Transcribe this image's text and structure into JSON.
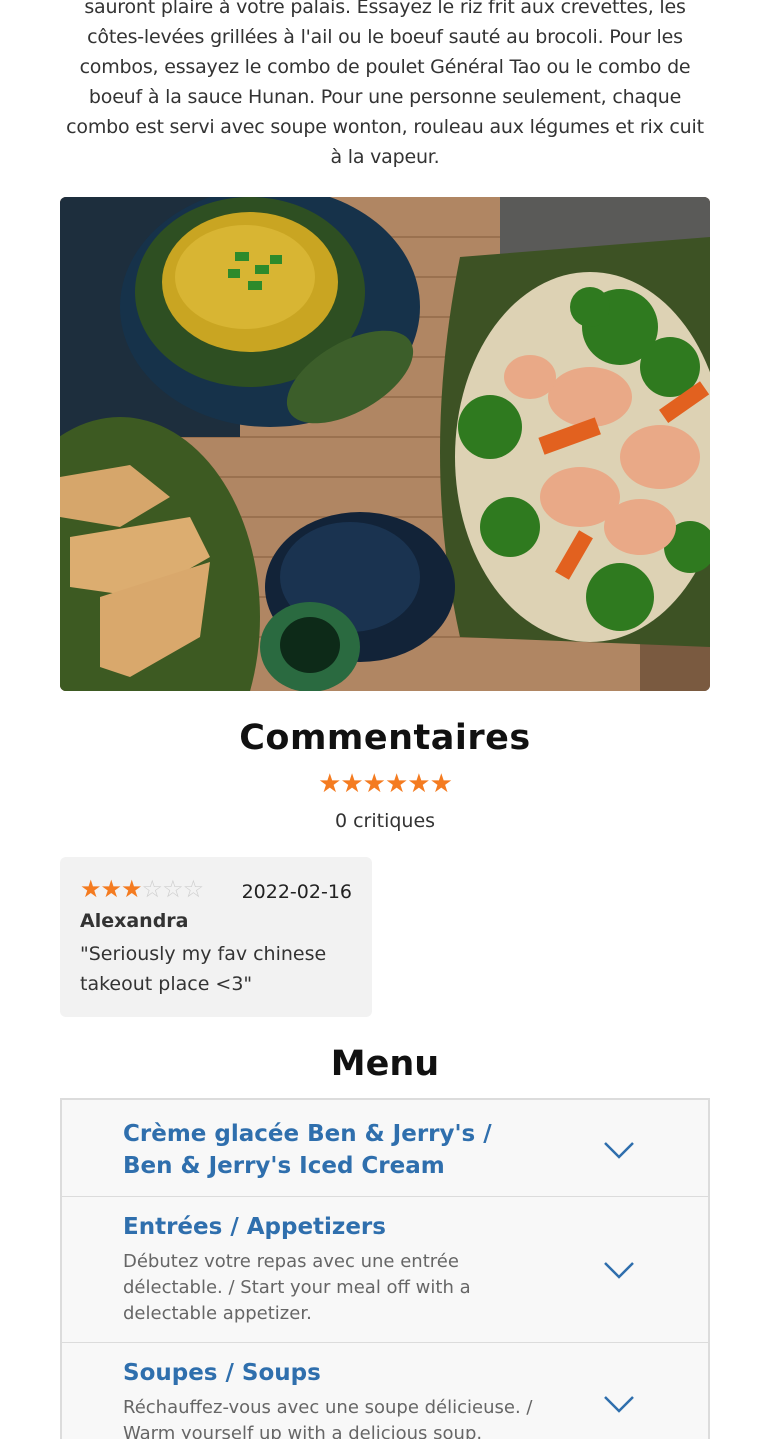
{
  "intro": {
    "text": "sauront plaire à votre palais. Essayez le riz frit aux crevettes, les côtes-levées grillées à l'ail ou le boeuf sauté au brocoli. Pour les combos, essayez le combo de poulet Général Tao ou le combo de boeuf à la sauce Hunan. Pour une personne seulement, chaque combo est servi avec soupe wonton, rouleau aux légumes et rix cuit à la vapeur."
  },
  "reviews": {
    "title": "Commentaires",
    "average_stars": "★★★★★★",
    "count_label": "0 critiques",
    "items": [
      {
        "rating": 3,
        "max_rating": 6,
        "stars_on": "★★★",
        "stars_off": "☆☆☆",
        "date": "2022-02-16",
        "author": "Alexandra",
        "text": "\"Seriously my fav chinese takeout place <3\""
      }
    ]
  },
  "menu": {
    "title": "Menu",
    "sections": [
      {
        "title": "Crème glacée Ben & Jerry's / Ben & Jerry's Iced Cream",
        "description": ""
      },
      {
        "title": "Entrées / Appetizers",
        "description": "Débutez votre repas avec une entrée délectable. / Start your meal off with a delectable appetizer."
      },
      {
        "title": "Soupes / Soups",
        "description": "Réchauffez-vous avec une soupe délicieuse. / Warm yourself up with a delicious soup."
      }
    ]
  },
  "colors": {
    "accent_orange": "#f47b20",
    "link_blue": "#2f6fad"
  },
  "icons": {
    "star": "star-icon",
    "chevron": "chevron-down-icon"
  }
}
